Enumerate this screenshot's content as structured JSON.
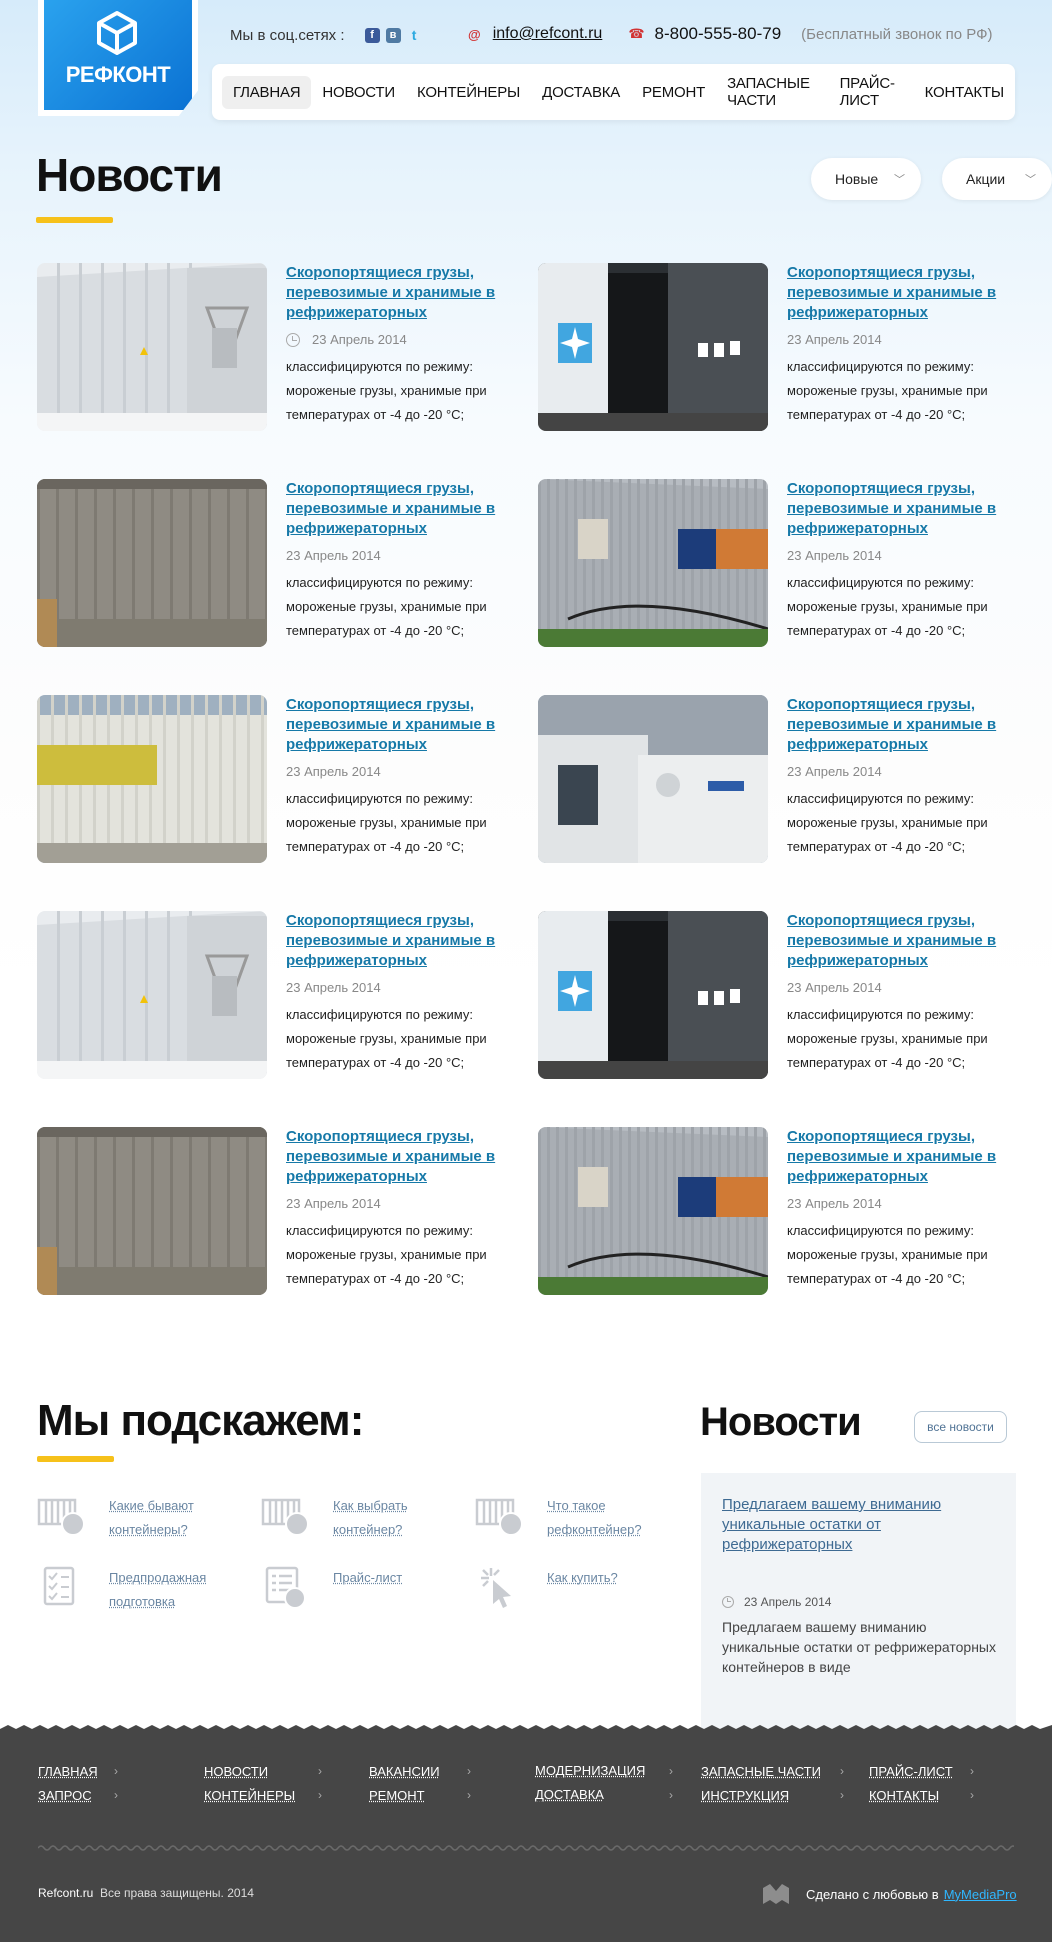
{
  "header": {
    "logo_text": "РЕФКОНТ",
    "social_label": "Мы в соц.сетях :",
    "social": [
      "f",
      "в",
      "t"
    ],
    "email": "info@refcont.ru",
    "phone": "8-800-555-80-79",
    "free_call": "(Бесплатный звонок по РФ)"
  },
  "nav": {
    "items": [
      "ГЛАВНАЯ",
      "НОВОСТИ",
      "КОНТЕЙНЕРЫ",
      "ДОСТАВКА",
      "РЕМОНТ",
      "ЗАПАСНЫЕ ЧАСТИ",
      "ПРАЙС-ЛИСТ",
      "КОНТАКТЫ"
    ],
    "active": "ГЛАВНАЯ"
  },
  "page": {
    "title": "Новости",
    "filter_new": "Новые",
    "filter_promo": "Акции"
  },
  "news": {
    "items": [
      {
        "title": "Скоропортящиеся грузы, перевозимые и хранимые в рефрижераторных",
        "date": "23 Апрель 2014",
        "text": "классифицируются по режиму: мороженые грузы, хранимые при температурах от -4 до -20 °С;",
        "image": "white-reefer"
      },
      {
        "title": "Скоропортящиеся грузы, перевозимые и хранимые в рефрижераторных",
        "date": "23 Апрель 2014",
        "text": "классифицируются по режиму: мороженые грузы, хранимые при температурах от -4 до -20 °С;",
        "image": "maersk-open"
      },
      {
        "title": "Скоропортящиеся грузы, перевозимые и хранимые в рефрижераторных",
        "date": "23 Апрель 2014",
        "text": "классифицируются по режиму: мороженые грузы, хранимые при температурах от -4 до -20 °С;",
        "image": "rusty-container"
      },
      {
        "title": "Скоропортящиеся грузы, перевозимые и хранимые в рефрижераторных",
        "date": "23 Апрель 2014",
        "text": "классифицируются по режиму: мороженые грузы, хранимые при температурах от -4 до -20 °С;",
        "image": "po-nedlloyd"
      },
      {
        "title": "Скоропортящиеся грузы, перевозимые и хранимые в рефрижераторных",
        "date": "23 Апрель 2014",
        "text": "классифицируются по режиму: мороженые грузы, хранимые при температурах от -4 до -20 °С;",
        "image": "ym-line"
      },
      {
        "title": "Скоропортящиеся грузы, перевозимые и хранимые в рефрижераторных",
        "date": "23 Апрель 2014",
        "text": "классифицируются по режиму: мороженые грузы, хранимые при температурах от -4 до -20 °С;",
        "image": "carrier-units"
      },
      {
        "title": "Скоропортящиеся грузы, перевозимые и хранимые в рефрижераторных",
        "date": "23 Апрель 2014",
        "text": "классифицируются по режиму: мороженые грузы, хранимые при температурах от -4 до -20 °С;",
        "image": "white-reefer"
      },
      {
        "title": "Скоропортящиеся грузы, перевозимые и хранимые в рефрижераторных",
        "date": "23 Апрель 2014",
        "text": "классифицируются по режиму: мороженые грузы, хранимые при температурах от -4 до -20 °С;",
        "image": "maersk-open"
      },
      {
        "title": "Скоропортящиеся грузы, перевозимые и хранимые в рефрижераторных",
        "date": "23 Апрель 2014",
        "text": "классифицируются по режиму: мороженые грузы, хранимые при температурах от -4 до -20 °С;",
        "image": "rusty-container"
      },
      {
        "title": "Скоропортящиеся грузы, перевозимые и хранимые в рефрижераторных",
        "date": "23 Апрель 2014",
        "text": "классифицируются по режиму: мороженые грузы, хранимые при температурах от -4 до -20 °С;",
        "image": "po-nedlloyd"
      }
    ]
  },
  "hints": {
    "title": "Мы подскажем:",
    "items": [
      {
        "label": "Какие бывают контейнеры?",
        "icon": "container-icon"
      },
      {
        "label": "Как выбрать контейнер?",
        "icon": "container-icon"
      },
      {
        "label": "Что такое рефконтейнер?",
        "icon": "container-icon"
      },
      {
        "label": "Предпродажная подготовка",
        "icon": "checklist-icon"
      },
      {
        "label": "Прайс-лист",
        "icon": "price-list-icon"
      },
      {
        "label": "Как купить?",
        "icon": "cursor-click-icon"
      }
    ]
  },
  "side_news": {
    "title": "Новости",
    "all_news": "все новости",
    "link": "Предлагаем вашему вниманию уникальные остатки от рефрижераторных",
    "date": "23 Апрель 2014",
    "text": "Предлагаем вашему вниманию уникальные остатки от рефрижераторных контейнеров в виде"
  },
  "footer": {
    "links": [
      "ГЛАВНАЯ",
      "ЗАПРОС",
      "НОВОСТИ",
      "КОНТЕЙНЕРЫ",
      "ВАКАНСИИ",
      "РЕМОНТ",
      "МОДЕРНИЗАЦИЯ",
      "ДОСТАВКА",
      "ЗАПАСНЫЕ ЧАСТИ",
      "ИНСТРУКЦИЯ",
      "ПРАЙС-ЛИСТ",
      "КОНТАКТЫ"
    ],
    "site": "Refcont.ru",
    "rights": "Все права защищены. 2014",
    "made_with": "Сделано с любовью в",
    "studio": "MyMediaPro"
  },
  "colors": {
    "accent_yellow": "#f6c11a",
    "link_blue": "#1679a8",
    "logo_blue": "#0b72d3",
    "footer_bg": "#464646"
  }
}
